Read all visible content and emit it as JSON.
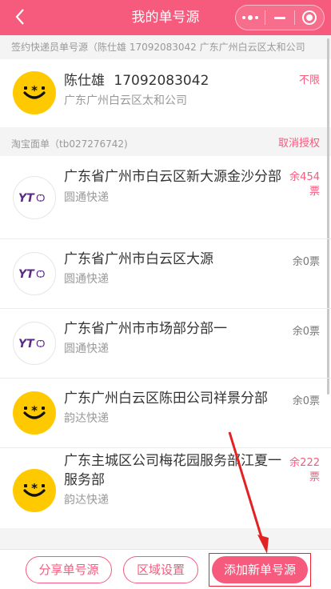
{
  "header": {
    "back_icon": "chevron-left-icon",
    "title": "我的单号源",
    "capsule_icons": [
      "more-icon",
      "minimize-icon",
      "target-icon"
    ]
  },
  "courier_section": {
    "label": "签约快递员单号源（陈仕雄 17092083042 广东广州白云区太和公司"
  },
  "courier": {
    "name": "陈仕雄",
    "phone": "17092083042",
    "company": "广东广州白云区太和公司",
    "quota": "不限",
    "logo": "yunda-smile-logo"
  },
  "taobao_section": {
    "label": "淘宝面单（tb027276742)",
    "revoke_label": "取消授权"
  },
  "sources": [
    {
      "name": "广东省广州市白云区新大源金沙分部",
      "carrier": "圆通快递",
      "quota": "余454票",
      "logo": "yto-logo",
      "quota_color": "#f65a7d"
    },
    {
      "name": "广东省广州市白云区大源",
      "carrier": "圆通快递",
      "quota": "余0票",
      "logo": "yto-logo",
      "quota_color": "#777777"
    },
    {
      "name": "广东省广州市市场部分部一",
      "carrier": "圆通快递",
      "quota": "余0票",
      "logo": "yto-logo",
      "quota_color": "#777777"
    },
    {
      "name": "广东广州白云区陈田公司祥景分部",
      "carrier": "韵达快递",
      "quota": "余0票",
      "logo": "yunda-smile-logo",
      "quota_color": "#777777"
    },
    {
      "name": "广东主城区公司梅花园服务部江夏一服务部",
      "carrier": "韵达快递",
      "quota": "余222票",
      "logo": "yunda-smile-logo",
      "quota_color": "#f65a7d"
    }
  ],
  "bottom": {
    "share_label": "分享单号源",
    "region_label": "区域设置",
    "add_label": "添加新单号源"
  },
  "colors": {
    "accent": "#f65a7d",
    "yunda_yellow": "#ffc900",
    "yto_purple": "#5a2a86",
    "annotation_red": "#e22222"
  }
}
